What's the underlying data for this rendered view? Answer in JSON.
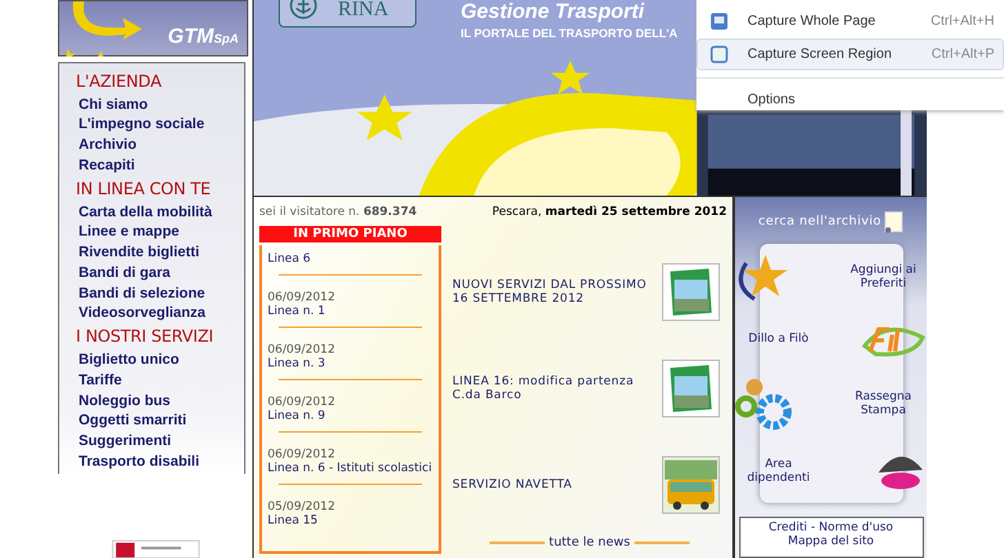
{
  "logo": {
    "brand": "GTM",
    "suffix": "SpA"
  },
  "banner": {
    "certification": "RINA",
    "title": "Gestione Trasporti",
    "subtitle": "IL PORTALE DEL TRASPORTO DELL'A"
  },
  "nav": [
    {
      "heading": "L'AZIENDA",
      "items": [
        "Chi siamo",
        "L'impegno sociale",
        "Archivio",
        "Recapiti"
      ]
    },
    {
      "heading": "IN LINEA CON TE",
      "items": [
        "Carta della mobilità",
        "Linee e mappe",
        "Rivendite biglietti",
        "Bandi di gara",
        "Bandi di selezione",
        "Videosorveglianza"
      ]
    },
    {
      "heading": "I NOSTRI SERVIZI",
      "items": [
        "Biglietto unico",
        "Tariffe",
        "Noleggio bus",
        "Oggetti smarriti",
        "Suggerimenti",
        "Trasporto disabili"
      ]
    }
  ],
  "visitor_counter": {
    "label": "sei il visitatore n.",
    "value": "689.374"
  },
  "date": {
    "place": "Pescara,",
    "day": "martedì 25 settembre 2012"
  },
  "featured": {
    "title": "IN PRIMO PIANO",
    "items": [
      {
        "title": "Linea 6"
      },
      {
        "date": "06/09/2012",
        "title": "Linea n. 1"
      },
      {
        "date": "06/09/2012",
        "title": "Linea n. 3"
      },
      {
        "date": "06/09/2012",
        "title": "Linea n. 9"
      },
      {
        "date": "06/09/2012",
        "title": "Linea n. 6 - Istituti scolastici"
      },
      {
        "date": "05/09/2012",
        "title": "Linea 15"
      }
    ]
  },
  "news": [
    {
      "title": "NUOVI SERVIZI DAL PROSSIMO 16 SETTEMBRE 2012",
      "kind": "brochure"
    },
    {
      "title": "LINEA 16: modifica partenza C.da Barco",
      "kind": "brochure"
    },
    {
      "title": "SERVIZIO NAVETTA",
      "kind": "bus"
    }
  ],
  "all_news": "tutte le news",
  "side": {
    "search": "cerca nell'archivio",
    "links": [
      {
        "label": "Aggiungi ai Preferiti",
        "kind": "star"
      },
      {
        "label": "Dillo a Filò",
        "kind": "mascot"
      },
      {
        "label": "Rassegna Stampa",
        "kind": "gears"
      },
      {
        "label": "Area dipendenti",
        "kind": "shell"
      }
    ],
    "footer": [
      "Crediti - Norme d'uso",
      "Mappa del sito"
    ]
  },
  "context_menu": [
    {
      "label": "Capture Whole Page",
      "shortcut": "Ctrl+Alt+H",
      "kind": "page",
      "selected": false
    },
    {
      "label": "Capture Screen Region",
      "shortcut": "Ctrl+Alt+P",
      "kind": "region",
      "selected": true
    },
    {
      "label": "Options",
      "kind": "plain",
      "selected": false
    }
  ]
}
